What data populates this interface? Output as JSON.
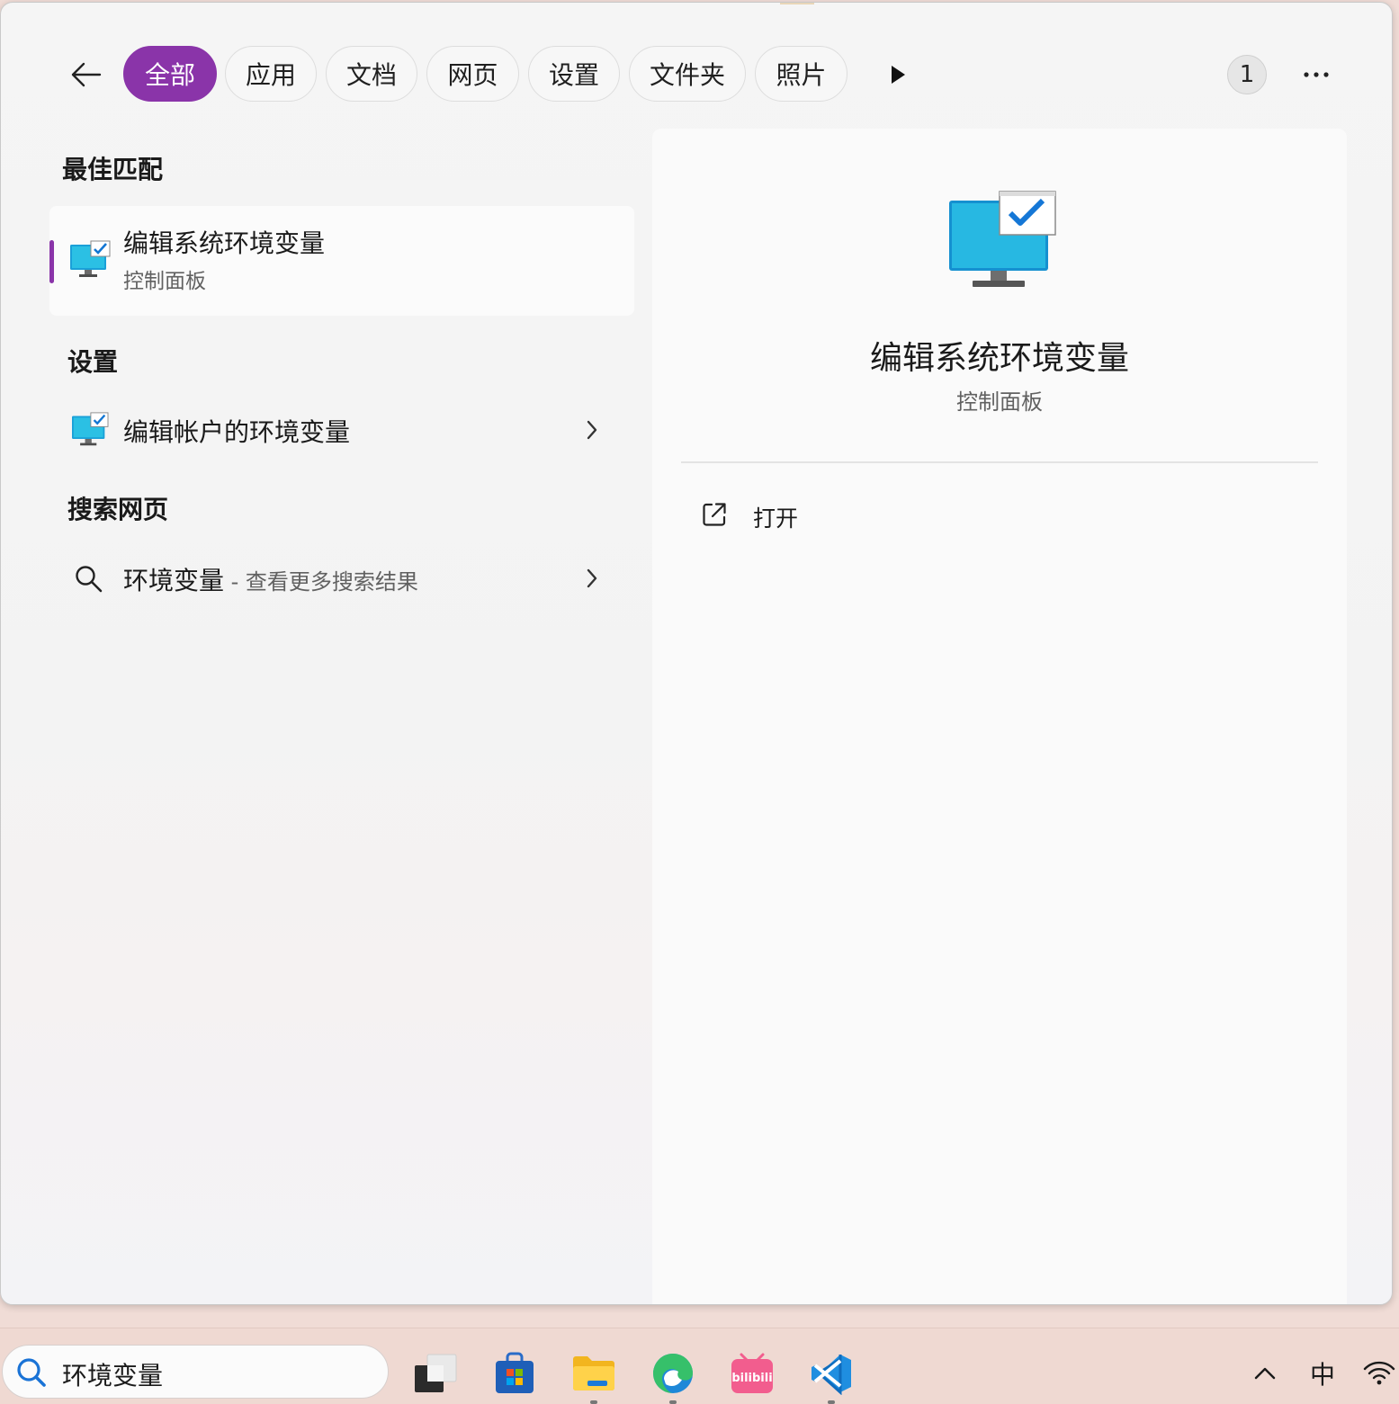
{
  "filters": {
    "tabs": [
      "全部",
      "应用",
      "文档",
      "网页",
      "设置",
      "文件夹",
      "照片"
    ],
    "active_tab": "全部",
    "result_count": "1"
  },
  "results": {
    "best_match_title": "最佳匹配",
    "best_match": {
      "name": "编辑系统环境变量",
      "subtitle": "控制面板"
    },
    "settings_title": "设置",
    "settings_item": "编辑帐户的环境变量",
    "web_title": "搜索网页",
    "web_query": "环境变量",
    "web_hint": " - 查看更多搜索结果"
  },
  "preview": {
    "name": "编辑系统环境变量",
    "subtitle": "控制面板",
    "open_label": "打开"
  },
  "taskbar": {
    "search_text": "环境变量",
    "apps": [
      "task-view",
      "microsoft-store",
      "file-explorer",
      "edge",
      "bilibili",
      "vs-code"
    ],
    "tray_ime": "中"
  },
  "colors": {
    "accent": "#8a34a9",
    "taskbar": "#efd9d2"
  }
}
